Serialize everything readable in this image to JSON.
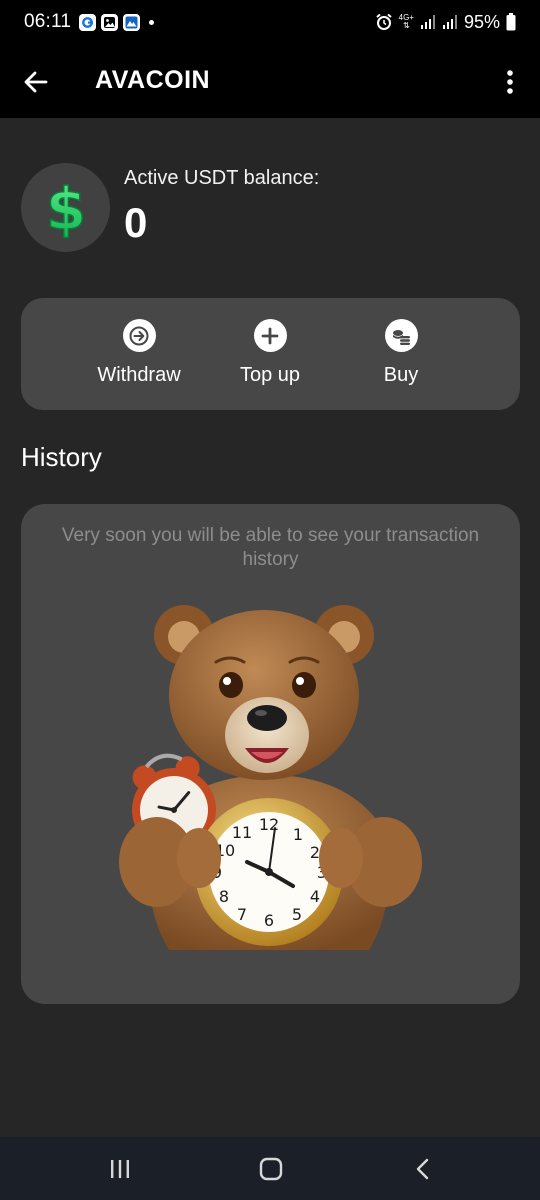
{
  "status_bar": {
    "time": "06:11",
    "network_label_top": "4G+",
    "network_label_bottom": "LTE",
    "battery": "95%"
  },
  "app_bar": {
    "title": "AVACOIN"
  },
  "balance": {
    "label": "Active USDT balance:",
    "value": "0",
    "avatar_symbol": "$",
    "accent_color": "#1fd76b"
  },
  "actions": [
    {
      "label": "Withdraw",
      "icon": "arrow-right-circle-icon"
    },
    {
      "label": "Top up",
      "icon": "plus-circle-icon"
    },
    {
      "label": "Buy",
      "icon": "coins-icon"
    }
  ],
  "history": {
    "title": "History",
    "empty_message": "Very soon you will be able to see your transaction history"
  },
  "colors": {
    "background": "#262626",
    "card": "#474747",
    "bar": "#000000"
  }
}
